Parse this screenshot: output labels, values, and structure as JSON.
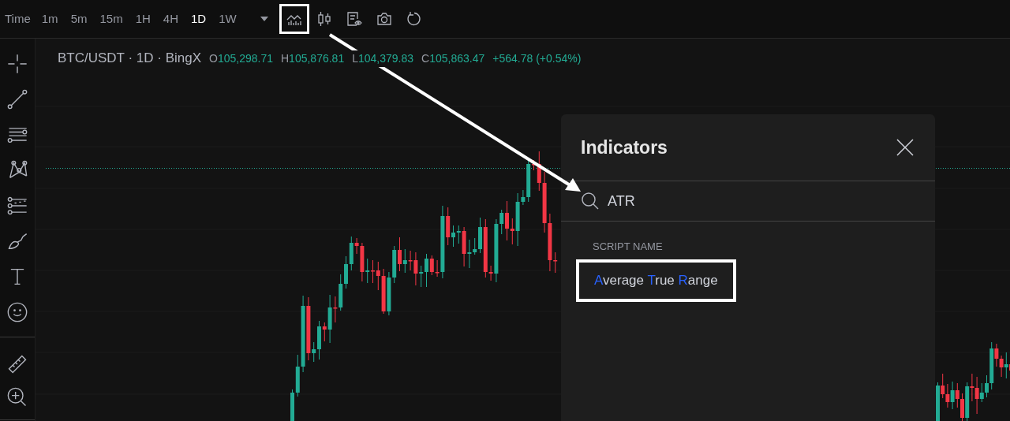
{
  "toolbar": {
    "time_label": "Time",
    "intervals": [
      {
        "label": "1m",
        "selected": false
      },
      {
        "label": "5m",
        "selected": false
      },
      {
        "label": "15m",
        "selected": false
      },
      {
        "label": "1H",
        "selected": false
      },
      {
        "label": "4H",
        "selected": false
      },
      {
        "label": "1D",
        "selected": true
      },
      {
        "label": "1W",
        "selected": false
      }
    ],
    "tools": [
      {
        "kind": "indicators",
        "highlighted": true
      },
      {
        "kind": "chart-type",
        "highlighted": false
      },
      {
        "kind": "script",
        "highlighted": false
      },
      {
        "kind": "snapshot",
        "highlighted": false
      },
      {
        "kind": "reload",
        "highlighted": false
      }
    ]
  },
  "legend": {
    "symbol": "BTC/USDT · 1D · BingX",
    "values": [
      {
        "label": "O",
        "value": "105,298.71"
      },
      {
        "label": "H",
        "value": "105,876.81"
      },
      {
        "label": "L",
        "value": "104,379.83"
      },
      {
        "label": "C",
        "value": "105,863.47"
      }
    ],
    "change": "+564.78 (+0.54%)"
  },
  "indicators_dialog": {
    "title": "Indicators",
    "search": {
      "value": "ATR"
    },
    "section": "SCRIPT NAME",
    "results": [
      {
        "highlighted": true,
        "segments": [
          {
            "text": "A",
            "match": true
          },
          {
            "text": "verage ",
            "match": false
          },
          {
            "text": "T",
            "match": true
          },
          {
            "text": "rue ",
            "match": false
          },
          {
            "text": "R",
            "match": true
          },
          {
            "text": "ange",
            "match": false
          }
        ]
      }
    ]
  }
}
